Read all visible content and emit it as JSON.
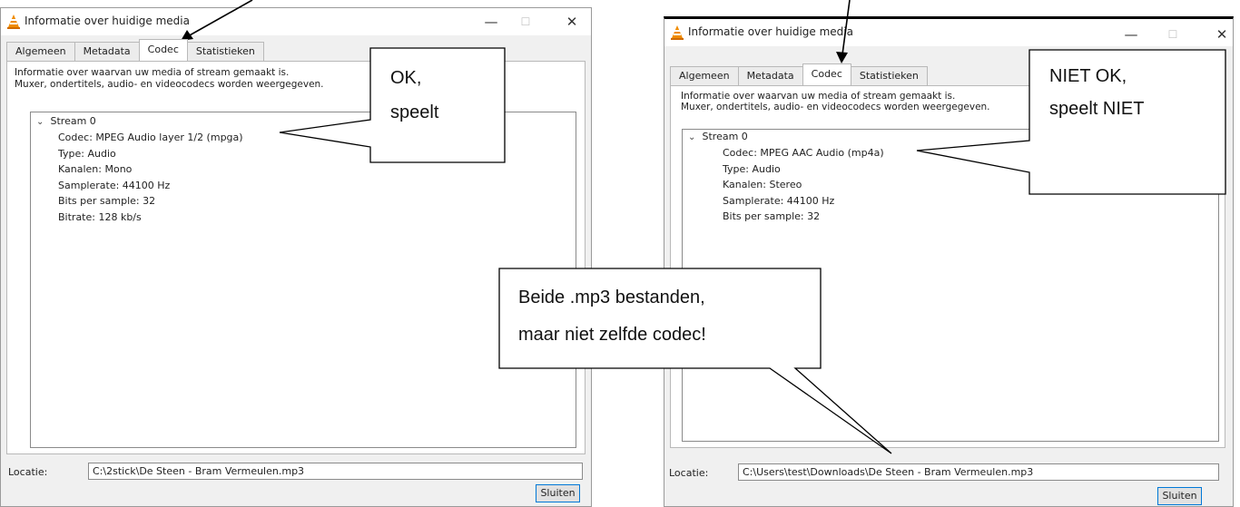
{
  "windows": {
    "left": {
      "title": "Informatie over huidige media",
      "controls": {
        "minimize": "—",
        "maximize": "☐",
        "close": "✕"
      },
      "tabs": [
        "Algemeen",
        "Metadata",
        "Codec",
        "Statistieken"
      ],
      "active_tab": "Codec",
      "description": [
        "Informatie over waarvan uw media of stream gemaakt is.",
        "Muxer, ondertitels, audio- en videocodecs worden weergegeven."
      ],
      "stream": {
        "label": "Stream 0",
        "chevron": "⌄",
        "properties": [
          "Codec: MPEG Audio layer 1/2 (mpga)",
          "Type: Audio",
          "Kanalen: Mono",
          "Samplerate: 44100 Hz",
          "Bits per sample: 32",
          "Bitrate: 128 kb/s"
        ]
      },
      "location_label": "Locatie:",
      "location_value": "C:\\2stick\\De Steen - Bram Vermeulen.mp3",
      "close_button": "Sluiten"
    },
    "right": {
      "title": "Informatie over huidige media",
      "controls": {
        "minimize": "—",
        "maximize": "☐",
        "close": "✕"
      },
      "tabs": [
        "Algemeen",
        "Metadata",
        "Codec",
        "Statistieken"
      ],
      "active_tab": "Codec",
      "description": [
        "Informatie over waarvan uw media of stream gemaakt is.",
        "Muxer, ondertitels, audio- en videocodecs worden weergegeven."
      ],
      "stream": {
        "label": "Stream 0",
        "chevron": "⌄",
        "properties": [
          "Codec: MPEG AAC Audio (mp4a)",
          "Type: Audio",
          "Kanalen: Stereo",
          "Samplerate: 44100 Hz",
          "Bits per sample: 32"
        ]
      },
      "location_label": "Locatie:",
      "location_value": "C:\\Users\\test\\Downloads\\De Steen - Bram Vermeulen.mp3",
      "close_button": "Sluiten"
    }
  },
  "callouts": {
    "ok": [
      "OK,",
      "speelt"
    ],
    "not_ok": [
      "NIET OK,",
      "speelt NIET"
    ],
    "both": [
      "Beide .mp3 bestanden,",
      "maar niet zelfde codec!"
    ]
  },
  "colors": {
    "vlc_orange": "#f08c00",
    "focus_blue": "#0078d7"
  }
}
